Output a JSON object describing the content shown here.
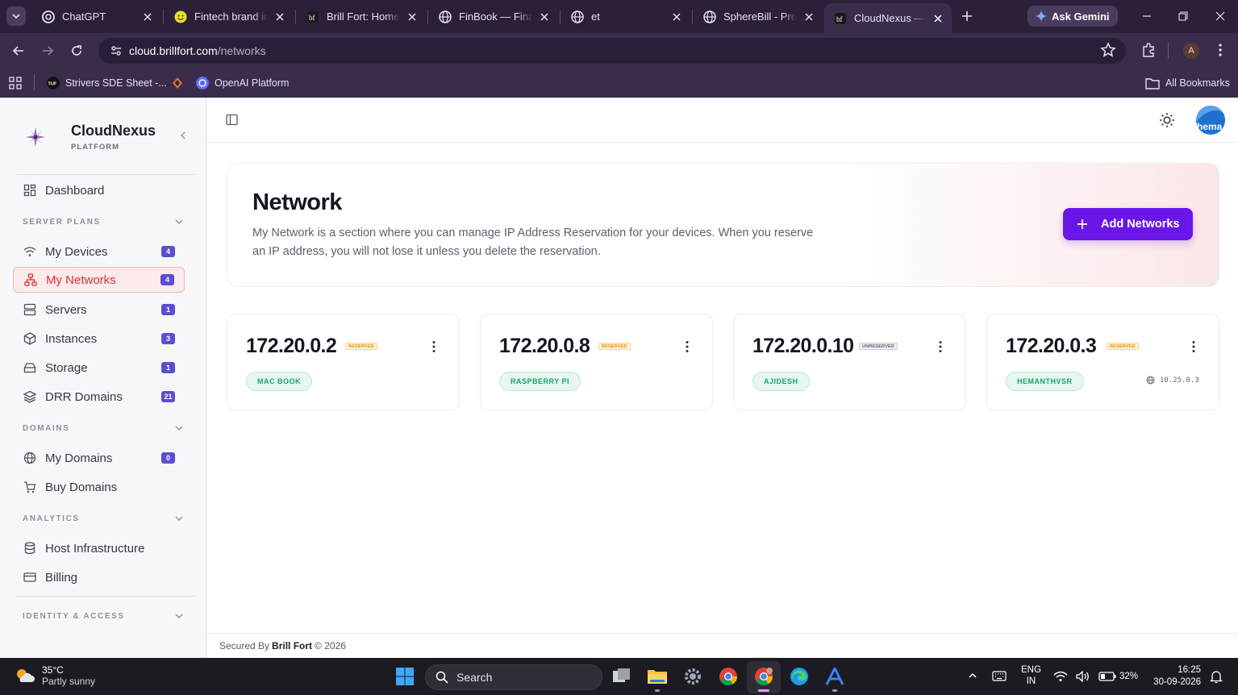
{
  "browser": {
    "tabs": [
      {
        "title": "ChatGPT",
        "favicon": "chatgpt-icon"
      },
      {
        "title": "Fintech brand ide",
        "favicon": "smiley-icon"
      },
      {
        "title": "Brill Fort: Home",
        "favicon": "brillfort-icon"
      },
      {
        "title": "FinBook — Financ",
        "favicon": "globe-icon"
      },
      {
        "title": "et",
        "favicon": "globe-icon"
      },
      {
        "title": "SphereBill - Prem",
        "favicon": "globe-icon"
      },
      {
        "title": "CloudNexus — E",
        "favicon": "brillfort-icon",
        "active": true
      }
    ],
    "ask_gemini": "Ask Gemini",
    "url_host": "cloud.brillfort.com",
    "url_path": "/networks",
    "profile_initial": "A",
    "bookmarks": [
      {
        "label": "Strivers SDE Sheet -..."
      },
      {
        "label": ""
      },
      {
        "label": "OpenAI Platform"
      }
    ],
    "all_bookmarks": "All Bookmarks"
  },
  "app": {
    "brand_name": "CloudNexus",
    "brand_sub": "PLATFORM",
    "nav": {
      "dashboard": "Dashboard",
      "server_plans": "SERVER PLANS",
      "my_devices": {
        "label": "My Devices",
        "badge": "4"
      },
      "my_networks": {
        "label": "My Networks",
        "badge": "4"
      },
      "servers": {
        "label": "Servers",
        "badge": "1"
      },
      "instances": {
        "label": "Instances",
        "badge": "3"
      },
      "storage": {
        "label": "Storage",
        "badge": "1"
      },
      "drr_domains": {
        "label": "DRR Domains",
        "badge": "21"
      },
      "domains": "DOMAINS",
      "my_domains": {
        "label": "My Domains",
        "badge": "0"
      },
      "buy_domains": "Buy Domains",
      "analytics": "ANALYTICS",
      "host_infra": "Host Infrastructure",
      "billing": "Billing",
      "identity": "IDENTITY & ACCESS"
    },
    "avatar_text": "hema",
    "hero": {
      "title": "Network",
      "description": "My Network is a section where you can manage IP Address Reservation for your devices. When you reserve an IP address, you will not lose it unless you delete the reservation.",
      "add_button": "Add Networks"
    },
    "networks": [
      {
        "ip": "172.20.0.2",
        "status": "RESERVED",
        "device": "MAC BOOK",
        "external_ip": ""
      },
      {
        "ip": "172.20.0.8",
        "status": "RESERVED",
        "device": "RASPBERRY PI",
        "external_ip": ""
      },
      {
        "ip": "172.20.0.10",
        "status": "UNRESERVED",
        "device": "AJIDESH",
        "external_ip": ""
      },
      {
        "ip": "172.20.0.3",
        "status": "RESERVED",
        "device": "HEMANTHVSR",
        "external_ip": "10.25.0.3"
      }
    ],
    "footer": {
      "prefix": "Secured By",
      "company": "Brill Fort",
      "suffix": "© 2026"
    },
    "colors": {
      "accent": "#6a16e8",
      "active_nav": "#d83232",
      "badge": "#5b4fcf",
      "tag": "#16a36a",
      "reserved": "#e08b00"
    }
  },
  "taskbar": {
    "temp": "35°C",
    "weather": "Partly sunny",
    "search": "Search",
    "lang1": "ENG",
    "lang2": "IN",
    "battery": "32%",
    "time": "16:25",
    "date": "30-09-2026"
  }
}
